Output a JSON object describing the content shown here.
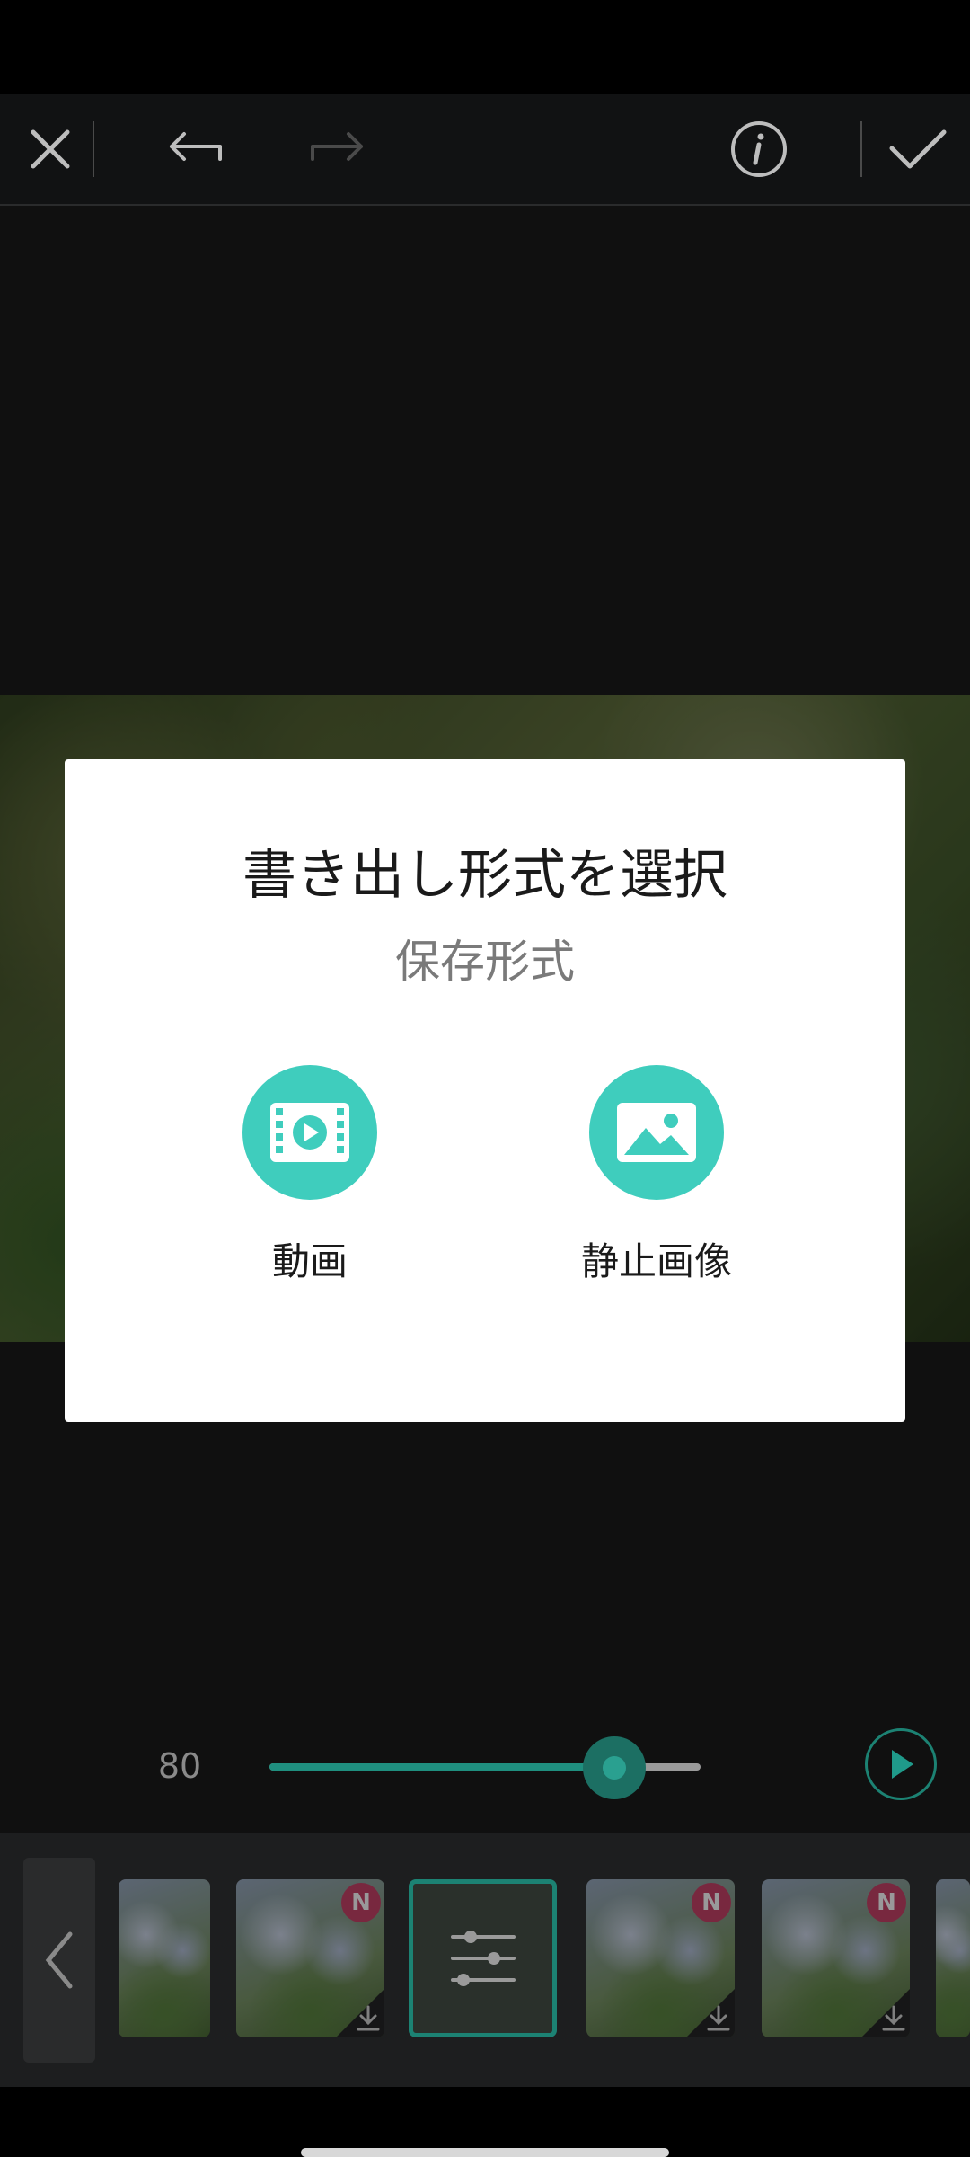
{
  "toolbar": {
    "close_icon": "close-icon",
    "undo_icon": "undo-icon",
    "redo_icon": "redo-icon",
    "info_icon": "info-icon",
    "confirm_icon": "check-icon"
  },
  "slider": {
    "value": "80",
    "fraction": 0.8,
    "accent_color": "#1f8f7f"
  },
  "filters": {
    "items": [
      {
        "type": "photo",
        "new": false,
        "downloadable": false
      },
      {
        "type": "photo",
        "new": true,
        "downloadable": true
      },
      {
        "type": "settings",
        "new": false,
        "downloadable": false,
        "selected": true
      },
      {
        "type": "photo",
        "new": true,
        "downloadable": true
      },
      {
        "type": "photo",
        "new": true,
        "downloadable": true
      },
      {
        "type": "photo",
        "new": false,
        "downloadable": false
      }
    ],
    "badge_label": "N"
  },
  "dialog": {
    "title": "書き出し形式を選択",
    "subtitle": "保存形式",
    "options": [
      {
        "label": "動画",
        "icon": "video-film-icon"
      },
      {
        "label": "静止画像",
        "icon": "image-icon"
      }
    ],
    "accent_color": "#3fcdbd"
  }
}
